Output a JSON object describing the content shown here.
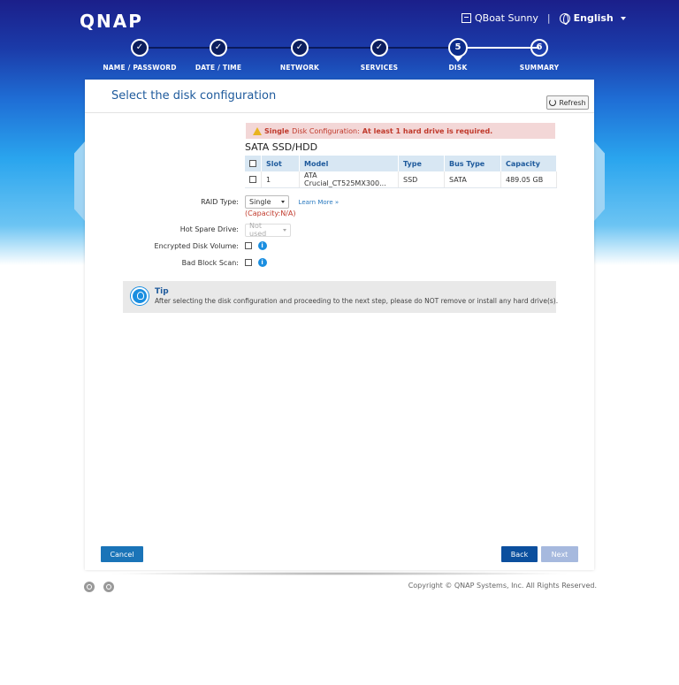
{
  "brand": {
    "logo_text": "QNAP"
  },
  "topbar": {
    "device_name": "QBoat Sunny",
    "language": "English"
  },
  "stepper": {
    "steps": [
      {
        "label": "NAME / PASSWORD",
        "state": "done",
        "marker": "✓"
      },
      {
        "label": "DATE / TIME",
        "state": "done",
        "marker": "✓"
      },
      {
        "label": "NETWORK",
        "state": "done",
        "marker": "✓"
      },
      {
        "label": "SERVICES",
        "state": "done",
        "marker": "✓"
      },
      {
        "label": "DISK",
        "state": "current",
        "marker": "5"
      },
      {
        "label": "SUMMARY",
        "state": "future",
        "marker": "6"
      }
    ]
  },
  "panel": {
    "title": "Select the disk configuration",
    "refresh_label": "Refresh"
  },
  "warning": {
    "mode": "Single",
    "prefix": "Disk Configuration:",
    "message": "At least 1 hard drive is required."
  },
  "disks": {
    "section_title": "SATA SSD/HDD",
    "columns": [
      "Slot",
      "Model",
      "Type",
      "Bus Type",
      "Capacity"
    ],
    "rows": [
      {
        "slot": "1",
        "model": "ATA Crucial_CT525MX300...",
        "type": "SSD",
        "bus_type": "SATA",
        "capacity": "489.05 GB"
      }
    ]
  },
  "form": {
    "raid_type_label": "RAID Type:",
    "raid_type_value": "Single",
    "learn_more": "Learn More »",
    "capacity_note": "(Capacity:N/A)",
    "hot_spare_label": "Hot Spare Drive:",
    "hot_spare_value": "Not used",
    "encrypted_label": "Encrypted Disk Volume:",
    "bad_block_label": "Bad Block Scan:"
  },
  "tip": {
    "title": "Tip",
    "text": "After selecting the disk configuration and proceeding to the next step, please do NOT remove or install any hard drive(s)."
  },
  "buttons": {
    "cancel": "Cancel",
    "back": "Back",
    "next": "Next"
  },
  "footer": {
    "copyright": "Copyright © QNAP Systems, Inc. All Rights Reserved."
  },
  "colors": {
    "accent": "#1e5a9c",
    "warning_bg": "#f3d7d7",
    "warning_text": "#c0392b",
    "next_disabled": "#a6b9de"
  }
}
